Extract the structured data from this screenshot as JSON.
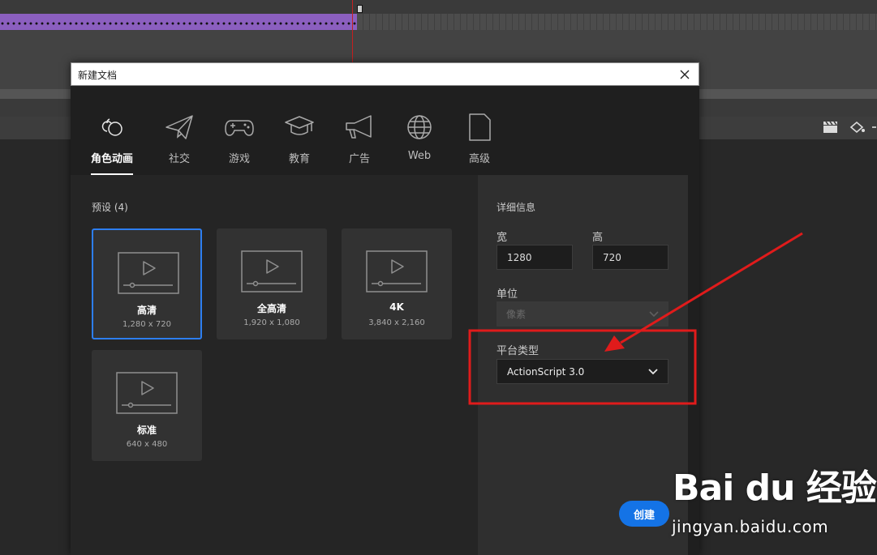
{
  "dialog": {
    "title": "新建文档",
    "categories": [
      {
        "label": "角色动画",
        "icon": "character-animation-icon",
        "active": true
      },
      {
        "label": "社交",
        "icon": "paper-plane-icon",
        "active": false
      },
      {
        "label": "游戏",
        "icon": "gamepad-icon",
        "active": false
      },
      {
        "label": "教育",
        "icon": "graduation-cap-icon",
        "active": false
      },
      {
        "label": "广告",
        "icon": "megaphone-icon",
        "active": false
      },
      {
        "label": "Web",
        "icon": "globe-icon",
        "active": false
      },
      {
        "label": "高级",
        "icon": "document-icon",
        "active": false
      }
    ],
    "presets_heading": "预设 (4)",
    "presets": [
      {
        "name": "高清",
        "size": "1,280 x 720",
        "selected": true
      },
      {
        "name": "全高清",
        "size": "1,920 x 1,080",
        "selected": false
      },
      {
        "name": "4K",
        "size": "3,840 x 2,160",
        "selected": false
      },
      {
        "name": "标准",
        "size": "640 x 480",
        "selected": false
      }
    ],
    "details": {
      "heading": "详细信息",
      "width_label": "宽",
      "width_value": "1280",
      "height_label": "高",
      "height_value": "720",
      "unit_label": "单位",
      "unit_value": "像素",
      "platform_label": "平台类型",
      "platform_value": "ActionScript 3.0"
    },
    "create_label": "创建"
  },
  "watermark": {
    "logo": "Bai du 经验",
    "url": "jingyan.baidu.com"
  },
  "colors": {
    "accent": "#1473e6",
    "selection": "#2d7ef0",
    "annotation": "#e01b1b",
    "timeline_span": "#8b5fbf"
  }
}
